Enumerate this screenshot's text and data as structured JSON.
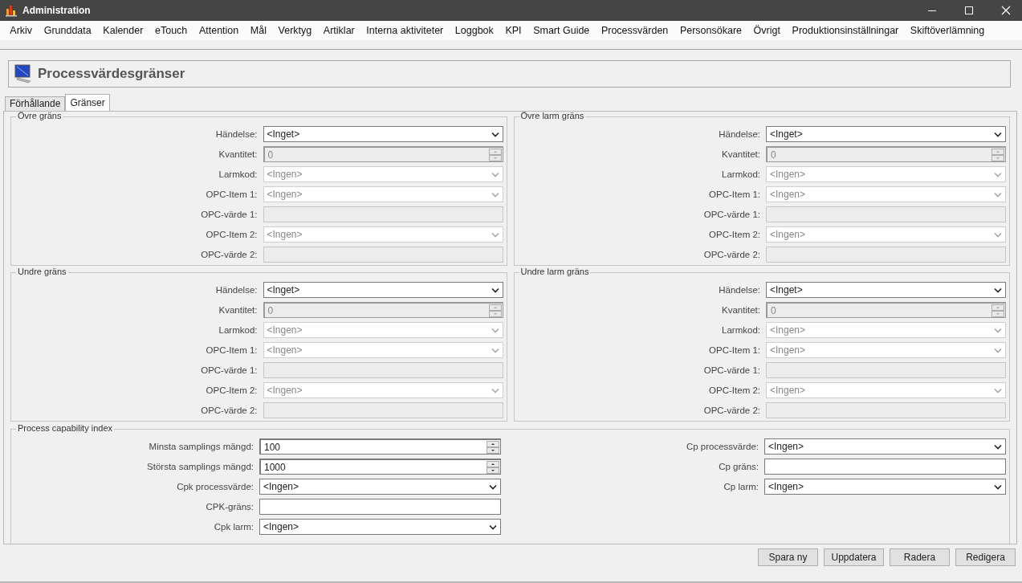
{
  "window": {
    "title": "Administration"
  },
  "menu": [
    "Arkiv",
    "Grunddata",
    "Kalender",
    "eTouch",
    "Attention",
    "Mål",
    "Verktyg",
    "Artiklar",
    "Interna aktiviteter",
    "Loggbok",
    "KPI",
    "Smart Guide",
    "Processvärden",
    "Personsökare",
    "Övrigt",
    "Produktionsinställningar",
    "Skiftöverlämning"
  ],
  "header": {
    "title": "Processvärdesgränser"
  },
  "tabs": [
    {
      "label": "Förhållande",
      "selected": false
    },
    {
      "label": "Gränser",
      "selected": true
    }
  ],
  "limit_groups": [
    {
      "title": "Övre gräns",
      "fields": [
        {
          "label": "Händelse:",
          "kind": "select",
          "value": "<Inget>",
          "disabled": false
        },
        {
          "label": "Kvantitet:",
          "kind": "spinner",
          "value": "0",
          "disabled": true
        },
        {
          "label": "Larmkod:",
          "kind": "select",
          "value": "<Ingen>",
          "disabled": true
        },
        {
          "label": "OPC-Item 1:",
          "kind": "select",
          "value": "<Ingen>",
          "disabled": true
        },
        {
          "label": "OPC-värde 1:",
          "kind": "text",
          "disabled": true
        },
        {
          "label": "OPC-Item 2:",
          "kind": "select",
          "value": "<Ingen>",
          "disabled": true
        },
        {
          "label": "OPC-värde 2:",
          "kind": "text",
          "disabled": true
        }
      ]
    },
    {
      "title": "Övre larm gräns",
      "fields": [
        {
          "label": "Händelse:",
          "kind": "select",
          "value": "<Inget>",
          "disabled": false
        },
        {
          "label": "Kvantitet:",
          "kind": "spinner",
          "value": "0",
          "disabled": true
        },
        {
          "label": "Larmkod:",
          "kind": "select",
          "value": "<Ingen>",
          "disabled": true
        },
        {
          "label": "OPC-Item 1:",
          "kind": "select",
          "value": "<Ingen>",
          "disabled": true
        },
        {
          "label": "OPC-värde 1:",
          "kind": "text",
          "disabled": true
        },
        {
          "label": "OPC-Item 2:",
          "kind": "select",
          "value": "<Ingen>",
          "disabled": true
        },
        {
          "label": "OPC-värde 2:",
          "kind": "text",
          "disabled": true
        }
      ]
    },
    {
      "title": "Undre gräns",
      "fields": [
        {
          "label": "Händelse:",
          "kind": "select",
          "value": "<Inget>",
          "disabled": false
        },
        {
          "label": "Kvantitet:",
          "kind": "spinner",
          "value": "0",
          "disabled": true
        },
        {
          "label": "Larmkod:",
          "kind": "select",
          "value": "<Ingen>",
          "disabled": true
        },
        {
          "label": "OPC-Item 1:",
          "kind": "select",
          "value": "<Ingen>",
          "disabled": true
        },
        {
          "label": "OPC-värde 1:",
          "kind": "text",
          "disabled": true
        },
        {
          "label": "OPC-Item 2:",
          "kind": "select",
          "value": "<Ingen>",
          "disabled": true
        },
        {
          "label": "OPC-värde 2:",
          "kind": "text",
          "disabled": true
        }
      ]
    },
    {
      "title": "Undre larm gräns",
      "fields": [
        {
          "label": "Händelse:",
          "kind": "select",
          "value": "<Inget>",
          "disabled": false
        },
        {
          "label": "Kvantitet:",
          "kind": "spinner",
          "value": "0",
          "disabled": true
        },
        {
          "label": "Larmkod:",
          "kind": "select",
          "value": "<Ingen>",
          "disabled": true
        },
        {
          "label": "OPC-Item 1:",
          "kind": "select",
          "value": "<Ingen>",
          "disabled": true
        },
        {
          "label": "OPC-värde 1:",
          "kind": "text",
          "disabled": true
        },
        {
          "label": "OPC-Item 2:",
          "kind": "select",
          "value": "<Ingen>",
          "disabled": true
        },
        {
          "label": "OPC-värde 2:",
          "kind": "text",
          "disabled": true
        }
      ]
    }
  ],
  "capability": {
    "title": "Process capability index",
    "left_fields": [
      {
        "label": "Minsta samplings mängd:",
        "kind": "spinner",
        "value": "100",
        "disabled": false
      },
      {
        "label": "Största samplings mängd:",
        "kind": "spinner",
        "value": "1000",
        "disabled": false
      },
      {
        "label": "Cpk processvärde:",
        "kind": "select",
        "value": "<Ingen>",
        "disabled": false
      },
      {
        "label": "CPK-gräns:",
        "kind": "text",
        "disabled": false
      },
      {
        "label": "Cpk larm:",
        "kind": "select",
        "value": "<Ingen>",
        "disabled": false
      }
    ],
    "right_fields": [
      {
        "label": "Cp processvärde:",
        "kind": "select",
        "value": "<Ingen>",
        "disabled": false
      },
      {
        "label": "Cp gräns:",
        "kind": "text",
        "disabled": false
      },
      {
        "label": "Cp larm:",
        "kind": "select",
        "value": "<Ingen>",
        "disabled": false
      }
    ]
  },
  "buttons": [
    "Spara ny",
    "Uppdatera",
    "Radera",
    "Redigera"
  ]
}
